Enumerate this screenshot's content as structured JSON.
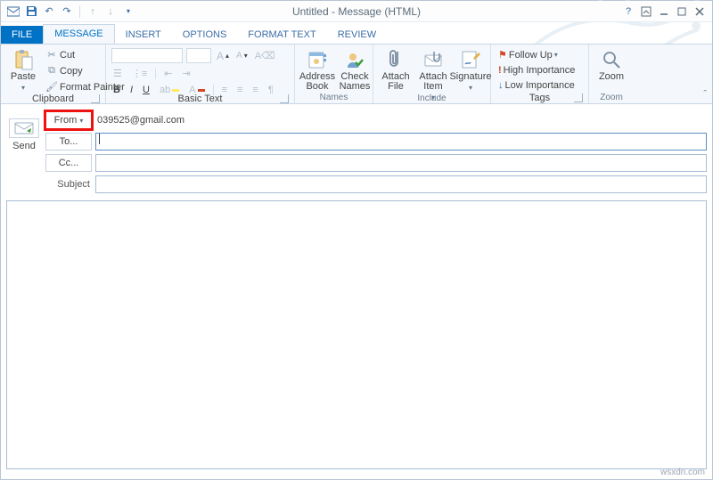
{
  "title": "Untitled - Message (HTML)",
  "tabs": {
    "file": "FILE",
    "message": "MESSAGE",
    "insert": "INSERT",
    "options": "OPTIONS",
    "format": "FORMAT TEXT",
    "review": "REVIEW"
  },
  "clipboard": {
    "paste": "Paste",
    "cut": "Cut",
    "copy": "Copy",
    "painter": "Format Painter",
    "label": "Clipboard"
  },
  "basictext": {
    "label": "Basic Text"
  },
  "names": {
    "address": "Address\nBook",
    "check": "Check\nNames",
    "label": "Names"
  },
  "include": {
    "attachfile": "Attach\nFile",
    "attachitem": "Attach\nItem",
    "signature": "Signature",
    "label": "Include"
  },
  "tags": {
    "followup": "Follow Up",
    "high": "High Importance",
    "low": "Low Importance",
    "label": "Tags"
  },
  "zoom": {
    "zoom": "Zoom",
    "label": "Zoom"
  },
  "compose": {
    "send": "Send",
    "from": "From",
    "to": "To...",
    "cc": "Cc...",
    "subject": "Subject",
    "from_value": "039525@gmail.com"
  },
  "footer": "wsxdn.com"
}
